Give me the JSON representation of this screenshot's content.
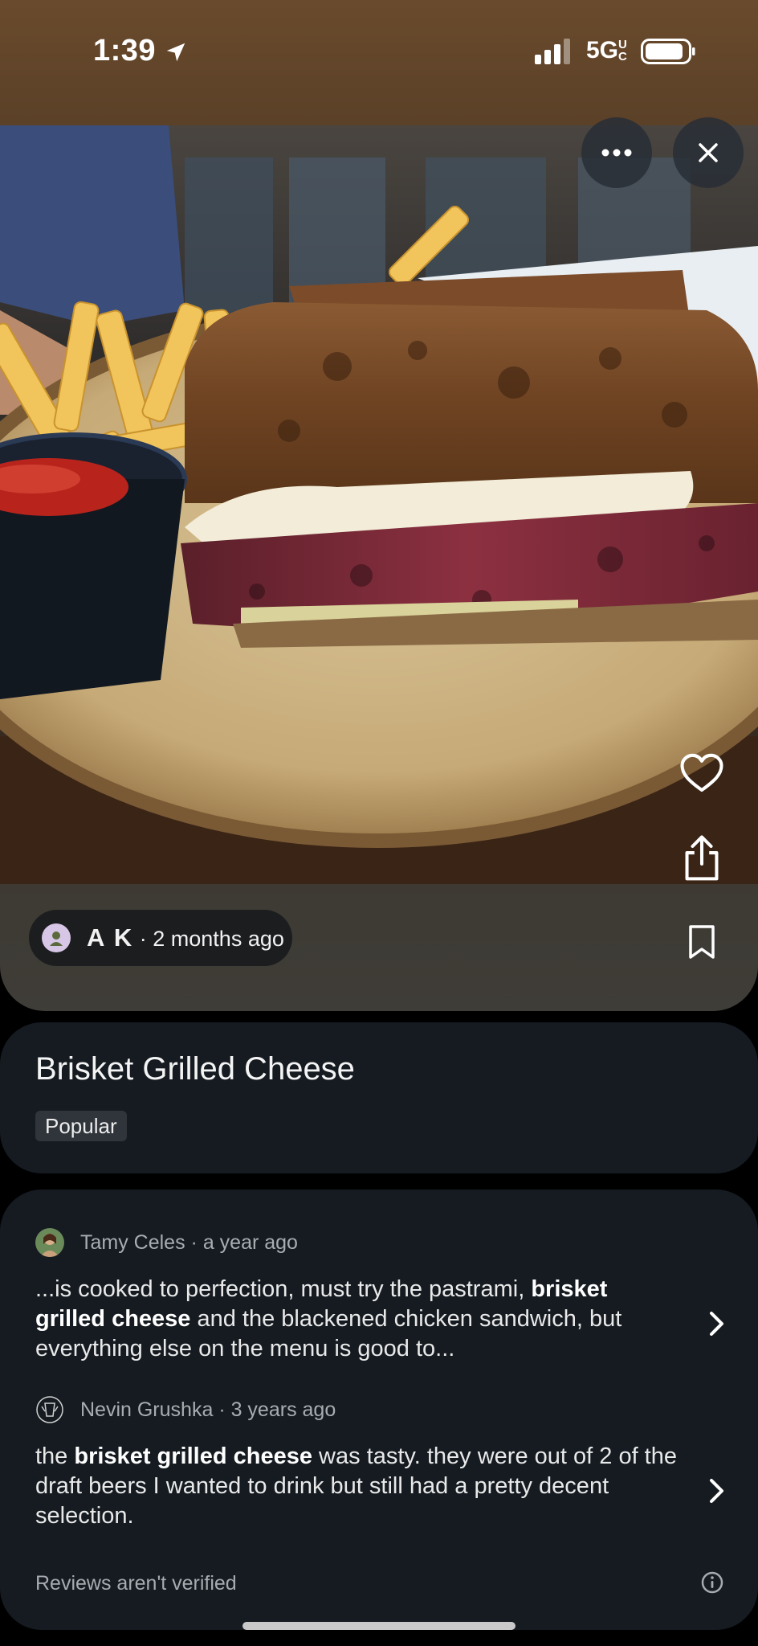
{
  "status_bar": {
    "time": "1:39",
    "network": "5G",
    "network_suffix": "UC"
  },
  "photo": {
    "alt_icon": "photo-of-sandwich-and-fries"
  },
  "photo_actions": {
    "more_icon": "ellipsis-icon",
    "close_icon": "close-icon",
    "like_icon": "heart-icon",
    "share_icon": "share-icon",
    "save_icon": "bookmark-icon"
  },
  "author": {
    "name": "A K",
    "time": "· 2 months ago"
  },
  "dish": {
    "title": "Brisket Grilled Cheese",
    "badge": "Popular"
  },
  "reviews": [
    {
      "author": "Tamy Celes",
      "time": "· a year ago",
      "before": "...is cooked to perfection, must try the pastrami, ",
      "highlight": "brisket grilled cheese",
      "after": " and the blackened chicken sandwich, but everything else on the menu is good to..."
    },
    {
      "author": "Nevin Grushka",
      "time": "· 3 years ago",
      "before": "the ",
      "highlight": "brisket grilled cheese",
      "after": " was tasty. they were out of 2 of the draft beers I wanted to drink but still had a pretty decent selection."
    }
  ],
  "footer": {
    "note": "Reviews aren't verified"
  },
  "colors": {
    "card_bg": "#151b21",
    "chip_bg": "#1c1d1f",
    "muted_text": "#a9adb2"
  }
}
